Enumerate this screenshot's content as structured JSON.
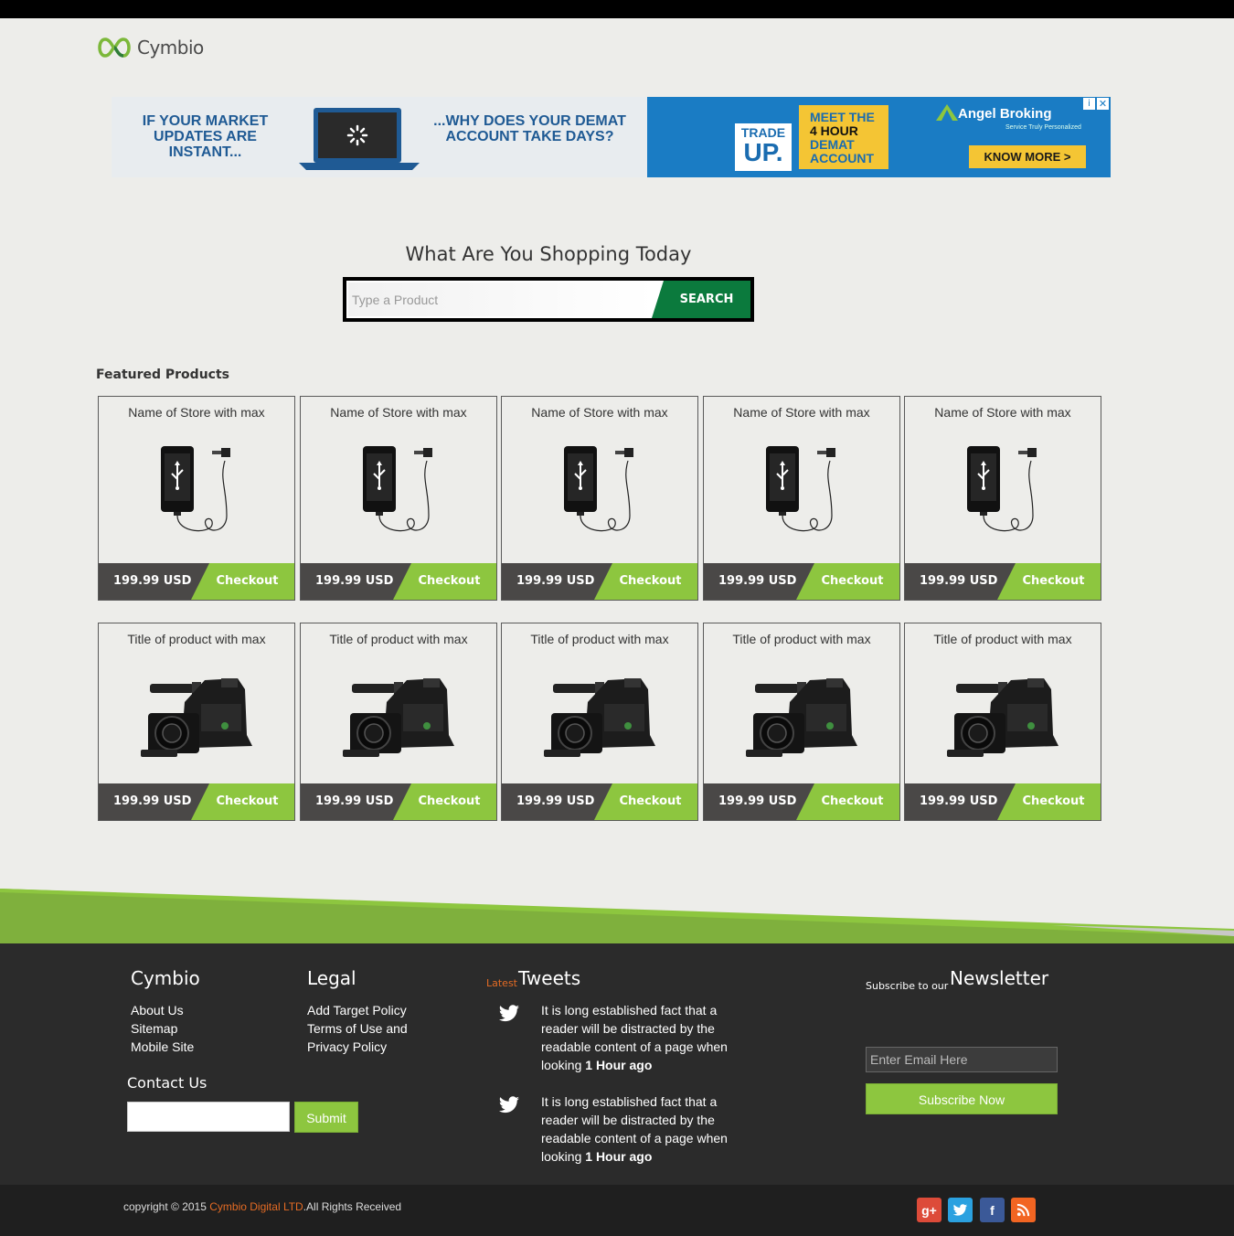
{
  "brand": {
    "name": "Cymbio",
    "logo_icon": "infinity-icon"
  },
  "ad": {
    "left_text_1": "IF YOUR MARKET UPDATES ARE INSTANT...",
    "left_text_2": "...WHY DOES YOUR DEMAT ACCOUNT TAKE DAYS?",
    "trade_line1": "TRADE",
    "trade_line2": "UP.",
    "meet_line1": "MEET THE",
    "meet_line2": "4 HOUR",
    "meet_line3": "DEMAT",
    "meet_line4": "ACCOUNT",
    "advertiser": "Angel Broking",
    "advertiser_tagline": "Service Truly Personalized",
    "cta": "KNOW MORE >",
    "info_icon": "i",
    "close_icon": "✕",
    "colors": {
      "left_bg": "#e8ecef",
      "right_bg": "#1a7cc4",
      "yellow": "#f4c534"
    }
  },
  "search": {
    "headline": "What Are You Shopping Today",
    "placeholder": "Type a Product",
    "button": "SEARCH"
  },
  "featured": {
    "heading": "Featured Products",
    "row1": [
      {
        "title": "Name of Store with max",
        "price": "199.99 USD",
        "cta": "Checkout",
        "image": "smartphone-usb-icon"
      },
      {
        "title": "Name of Store with max",
        "price": "199.99 USD",
        "cta": "Checkout",
        "image": "smartphone-usb-icon"
      },
      {
        "title": "Name of Store with max",
        "price": "199.99 USD",
        "cta": "Checkout",
        "image": "smartphone-usb-icon"
      },
      {
        "title": "Name of Store with max",
        "price": "199.99 USD",
        "cta": "Checkout",
        "image": "smartphone-usb-icon"
      },
      {
        "title": "Name of Store with max",
        "price": "199.99 USD",
        "cta": "Checkout",
        "image": "smartphone-usb-icon"
      }
    ],
    "row2": [
      {
        "title": "Title of product with max",
        "price": "199.99 USD",
        "cta": "Checkout",
        "image": "camcorder-icon"
      },
      {
        "title": "Title of product with max",
        "price": "199.99 USD",
        "cta": "Checkout",
        "image": "camcorder-icon"
      },
      {
        "title": "Title of product with max",
        "price": "199.99 USD",
        "cta": "Checkout",
        "image": "camcorder-icon"
      },
      {
        "title": "Title of product with max",
        "price": "199.99 USD",
        "cta": "Checkout",
        "image": "camcorder-icon"
      },
      {
        "title": "Title of product with max",
        "price": "199.99 USD",
        "cta": "Checkout",
        "image": "camcorder-icon"
      }
    ]
  },
  "footer": {
    "col1": {
      "heading": "Cymbio",
      "links": [
        "About Us",
        "Sitemap",
        "Mobile Site"
      ]
    },
    "col2": {
      "heading": "Legal",
      "links": [
        "Add Target Policy",
        "Terms of Use and",
        "Privacy Policy"
      ]
    },
    "contact": {
      "heading": "Contact Us",
      "button": "Submit"
    },
    "tweets": {
      "prefix": "Latest",
      "heading": "Tweets",
      "items": [
        {
          "text": "It is long established fact that a reader will be distracted by the readable content of a page when looking",
          "time": "1 Hour ago"
        },
        {
          "text": "It is long established fact that a reader will be distracted by the readable content of a page when looking",
          "time": "1 Hour ago"
        }
      ]
    },
    "newsletter": {
      "prefix": "Subscribe to our",
      "heading": "Newsletter",
      "placeholder": "Enter Email Here",
      "button": "Subscribe Now"
    },
    "copyright": {
      "prefix": "copyright © 2015",
      "brand": "Cymbio Digital LTD",
      "suffix": ".All Rights Received"
    },
    "social": [
      {
        "name": "google-plus-icon",
        "glyph": "g+",
        "color": "#dd4b39"
      },
      {
        "name": "twitter-icon",
        "glyph": "",
        "color": "#2ba1e0"
      },
      {
        "name": "facebook-icon",
        "glyph": "f",
        "color": "#3b5998"
      },
      {
        "name": "rss-icon",
        "glyph": "",
        "color": "#f26522"
      }
    ]
  },
  "colors": {
    "accent_green": "#8dc63f",
    "search_green": "#0b7a3d",
    "dark": "#2b2b2b",
    "orange": "#e46b24"
  }
}
